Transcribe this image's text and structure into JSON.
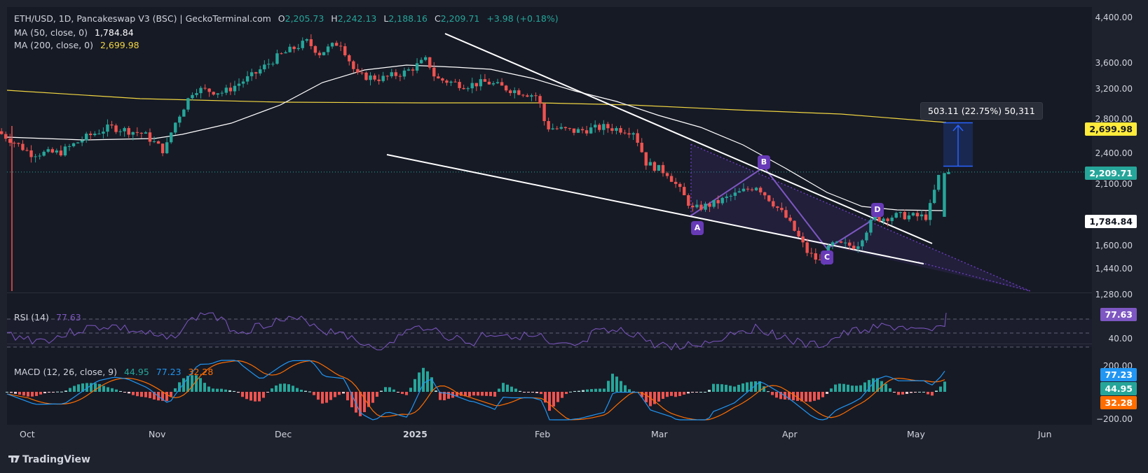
{
  "header": {
    "symbol": "ETH/USD, 1D, Pancakeswap V3 (BSC) | GeckoTerminal.com",
    "o_label": "O",
    "o_value": "2,205.73",
    "h_label": "H",
    "h_value": "2,242.13",
    "l_label": "L",
    "l_value": "2,188.16",
    "c_label": "C",
    "c_value": "2,209.71",
    "change": "+3.98 (+0.18%)",
    "ma50_label": "MA (50, close, 0)",
    "ma50_value": "1,784.84",
    "ma200_label": "MA (200, close, 0)",
    "ma200_value": "2,699.98"
  },
  "rsi": {
    "label": "RSI (14)",
    "value": "77.63"
  },
  "macd": {
    "label": "MACD (12, 26, close, 9)",
    "hist": "44.95",
    "macd": "77.23",
    "signal": "32.28"
  },
  "price_axis": [
    "4,400.00",
    "3,600.00",
    "3,200.00",
    "2,800.00",
    "2,400.00",
    "2,100.00",
    "1,600.00",
    "1,440.00",
    "1,280.00"
  ],
  "rsi_axis": [
    "40.00"
  ],
  "macd_axis": [
    "200.00",
    "−200.00"
  ],
  "badges": {
    "ma200": "2,699.98",
    "price": "2,209.71",
    "ma50": "1,784.84",
    "rsi": "77.63",
    "macd": "77.23",
    "hist": "44.95",
    "signal": "32.28"
  },
  "x_axis": [
    "Oct",
    "Nov",
    "Dec",
    "2025",
    "Feb",
    "Mar",
    "Apr",
    "May",
    "Jun"
  ],
  "pattern_points": [
    "A",
    "B",
    "C",
    "D"
  ],
  "measure": "503.11 (22.75%) 50,311",
  "brand": "TradingView",
  "colors": {
    "up": "#26a69a",
    "down": "#ef5350",
    "ma200": "#f0d542",
    "ma50": "#ffffff",
    "rsi": "#7e57c2",
    "macd": "#2196f3",
    "signal": "#ff6d00",
    "pattern": "#673ab7",
    "bg": "#161a25"
  },
  "chart_data": {
    "type": "candlestick",
    "title": "ETH/USD, 1D",
    "x_axis": [
      "Oct",
      "Nov",
      "Dec",
      "2025",
      "Feb",
      "Mar",
      "Apr",
      "May",
      "Jun"
    ],
    "y_axis_ticks": [
      1280,
      1440,
      1600,
      2100,
      2400,
      2800,
      3200,
      3600,
      4400
    ],
    "series": [
      {
        "name": "MA (50, close, 0)",
        "last": 1784.84
      },
      {
        "name": "MA (200, close, 0)",
        "last": 2699.98
      }
    ],
    "close_path": [
      [
        "Sep 25",
        2650
      ],
      [
        "Oct 3",
        2400
      ],
      [
        "Oct 10",
        2410
      ],
      [
        "Oct 17",
        2600
      ],
      [
        "Oct 22",
        2700
      ],
      [
        "Oct 30",
        2620
      ],
      [
        "Nov 4",
        2420
      ],
      [
        "Nov 6",
        2700
      ],
      [
        "Nov 11",
        3200
      ],
      [
        "Nov 18",
        3150
      ],
      [
        "Nov 25",
        3400
      ],
      [
        "Dec 1",
        3700
      ],
      [
        "Dec 8",
        3950
      ],
      [
        "Dec 11",
        3750
      ],
      [
        "Dec 16",
        3950
      ],
      [
        "Dec 20",
        3400
      ],
      [
        "Dec 26",
        3350
      ],
      [
        "Jan 1",
        3450
      ],
      [
        "Jan 6",
        3650
      ],
      [
        "Jan 8",
        3350
      ],
      [
        "Jan 15",
        3250
      ],
      [
        "Jan 20",
        3300
      ],
      [
        "Jan 25",
        3200
      ],
      [
        "Feb 1",
        3100
      ],
      [
        "Feb 3",
        2700
      ],
      [
        "Feb 10",
        2650
      ],
      [
        "Feb 17",
        2700
      ],
      [
        "Feb 24",
        2650
      ],
      [
        "Feb 27",
        2300
      ],
      [
        "Mar 4",
        2200
      ],
      [
        "Mar 10",
        1870
      ],
      [
        "Mar 15",
        1920
      ],
      [
        "Mar 20",
        2000
      ],
      [
        "Mar 25",
        2080
      ],
      [
        "Apr 1",
        1800
      ],
      [
        "Apr 6",
        1550
      ],
      [
        "Apr 9",
        1480
      ],
      [
        "Apr 12",
        1600
      ],
      [
        "Apr 18",
        1590
      ],
      [
        "Apr 22",
        1790
      ],
      [
        "Apr 28",
        1820
      ],
      [
        "May 5",
        1810
      ],
      [
        "May 8",
        2209.71
      ]
    ],
    "last": {
      "open": 2205.73,
      "high": 2242.13,
      "low": 2188.16,
      "close": 2209.71
    },
    "rsi_last": 77.63,
    "macd_last": {
      "macd": 77.23,
      "signal": 32.28,
      "histogram": 44.95
    }
  }
}
